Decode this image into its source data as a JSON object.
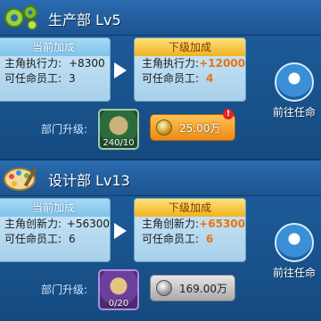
{
  "departments": [
    {
      "title": "生产部 Lv5",
      "icon": "gears-icon",
      "current": {
        "heading": "当前加成",
        "rows": [
          {
            "label": "主角执行力:",
            "value": "+8300"
          },
          {
            "label": "可任命员工:",
            "value": "3"
          }
        ]
      },
      "next": {
        "heading": "下级加成",
        "rows": [
          {
            "label": "主角执行力:",
            "value": "+12000"
          },
          {
            "label": "可任命员工:",
            "value": "4"
          }
        ]
      },
      "upgrade_label": "部门升级:",
      "item_count": "240/10",
      "cost": "25.00万",
      "alert": "!",
      "goto_label": "前往任命"
    },
    {
      "title": "设计部 Lv13",
      "icon": "palette-icon",
      "current": {
        "heading": "当前加成",
        "rows": [
          {
            "label": "主角创新力:",
            "value": "+56300"
          },
          {
            "label": "可任命员工:",
            "value": "6"
          }
        ]
      },
      "next": {
        "heading": "下级加成",
        "rows": [
          {
            "label": "主角创新力:",
            "value": "+65300"
          },
          {
            "label": "可任命员工:",
            "value": "6"
          }
        ]
      },
      "upgrade_label": "部门升级:",
      "item_count": "0/20",
      "cost": "169.00万",
      "goto_label": "前往任命"
    }
  ]
}
